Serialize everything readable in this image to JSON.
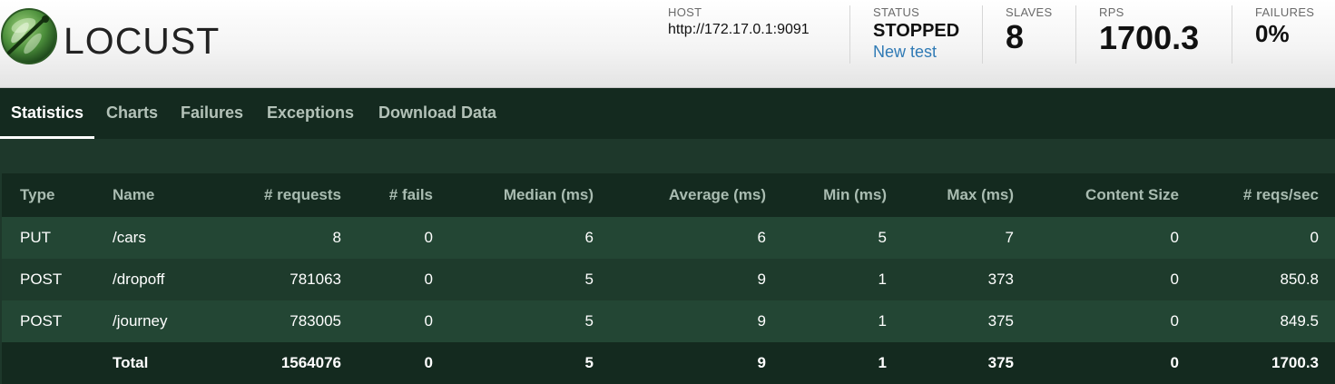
{
  "app": {
    "logo_text": "LOCUST",
    "logo_icon": "locust-dragonfly-logo-icon"
  },
  "header": {
    "host": {
      "label": "HOST",
      "value": "http://172.17.0.1:9091"
    },
    "status": {
      "label": "STATUS",
      "value": "STOPPED",
      "new_test_label": "New test"
    },
    "slaves": {
      "label": "SLAVES",
      "value": "8"
    },
    "rps": {
      "label": "RPS",
      "value": "1700.3"
    },
    "failures": {
      "label": "FAILURES",
      "value": "0%"
    }
  },
  "tabs": [
    {
      "label": "Statistics",
      "active": true
    },
    {
      "label": "Charts",
      "active": false
    },
    {
      "label": "Failures",
      "active": false
    },
    {
      "label": "Exceptions",
      "active": false
    },
    {
      "label": "Download Data",
      "active": false
    }
  ],
  "table": {
    "columns": [
      "Type",
      "Name",
      "# requests",
      "# fails",
      "Median (ms)",
      "Average (ms)",
      "Min (ms)",
      "Max (ms)",
      "Content Size",
      "# reqs/sec"
    ],
    "rows": [
      [
        "PUT",
        "/cars",
        "8",
        "0",
        "6",
        "6",
        "5",
        "7",
        "0",
        "0"
      ],
      [
        "POST",
        "/dropoff",
        "781063",
        "0",
        "5",
        "9",
        "1",
        "373",
        "0",
        "850.8"
      ],
      [
        "POST",
        "/journey",
        "783005",
        "0",
        "5",
        "9",
        "1",
        "375",
        "0",
        "849.5"
      ]
    ],
    "total": [
      "",
      "Total",
      "1564076",
      "0",
      "5",
      "9",
      "1",
      "375",
      "0",
      "1700.3"
    ]
  },
  "colors": {
    "header_bg": "#f4f4f4",
    "tabbar_bg": "#142a1f",
    "content_bg": "#1e382b",
    "row_alt": "#234634",
    "link": "#2f7ab5"
  }
}
